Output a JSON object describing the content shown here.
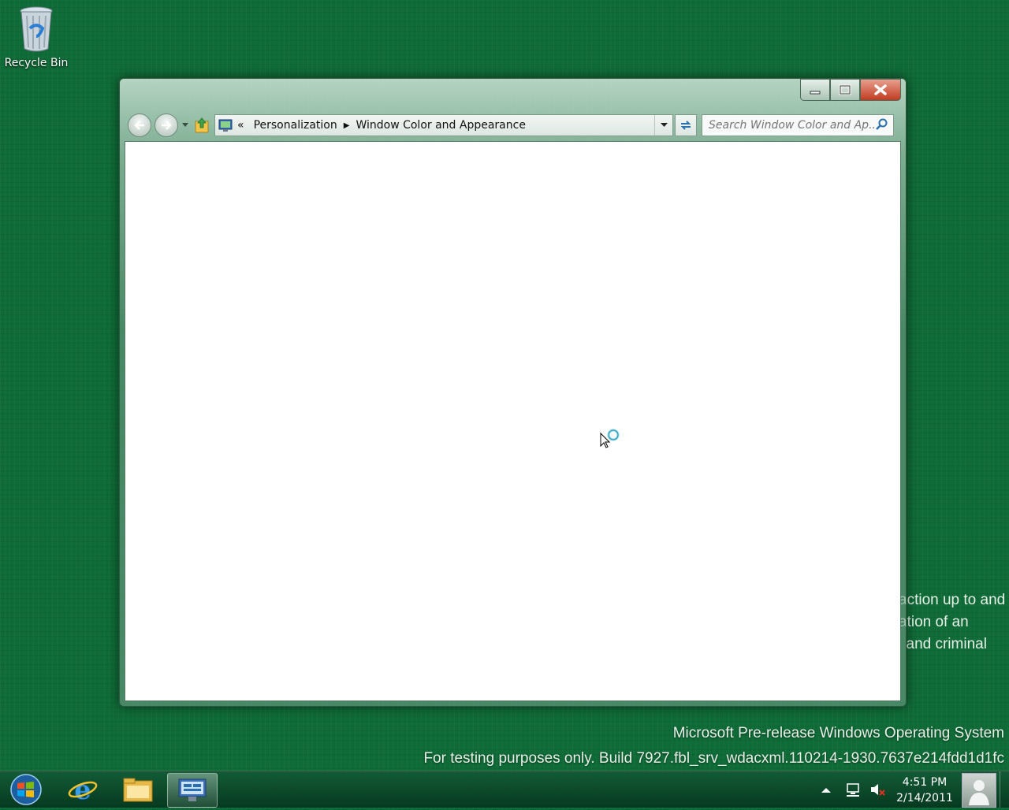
{
  "desktop": {
    "recycle_bin_label": "Recycle Bin",
    "legal_lines": [
      "action up to and",
      "ation of an",
      "l and criminal"
    ],
    "watermark_line1": "Microsoft Pre-release Windows Operating System",
    "watermark_line2": "For testing purposes only. Build 7927.fbl_srv_wdacxml.110214-1930.7637e214fdd1d1fc"
  },
  "window": {
    "breadcrumb": {
      "overflow": "«",
      "items": [
        "Personalization",
        "Window Color and Appearance"
      ]
    },
    "search_placeholder": "Search Window Color and Ap..."
  },
  "taskbar": {
    "pinned": [
      "start-button",
      "internet-explorer",
      "windows-explorer",
      "control-panel"
    ],
    "clock_time": "4:51 PM",
    "clock_date": "2/14/2011"
  },
  "colors": {
    "desktop": "#0f6b37",
    "close_button": "#c23a20"
  }
}
